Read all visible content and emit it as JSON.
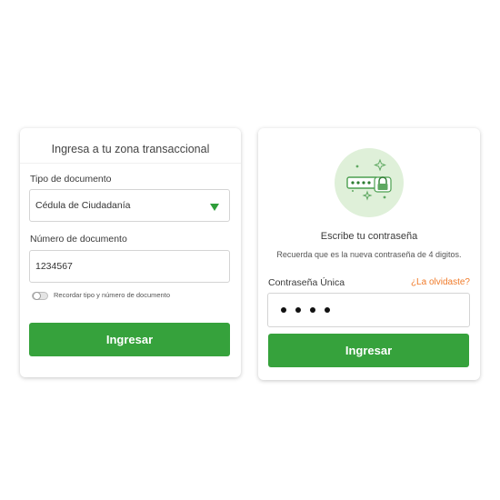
{
  "login": {
    "title": "Ingresa a tu zona transaccional",
    "doc_type_label": "Tipo de documento",
    "doc_type_value": "Cédula de Ciudadanía",
    "doc_number_label": "Número de documento",
    "doc_number_value": "1234567",
    "remember_label": "Recordar tipo y número de documento",
    "remember_on": false,
    "submit_label": "Ingresar"
  },
  "password": {
    "icon": "password-lock-icon",
    "title": "Escribe tu contraseña",
    "hint": "Recuerda que es la nueva contraseña de 4 digitos.",
    "field_label": "Contraseña Única",
    "forgot_label": "¿La olvidaste?",
    "masked_digits": 4,
    "submit_label": "Ingresar"
  },
  "colors": {
    "primary_green": "#36a23c",
    "arrow_green": "#2e9e3a",
    "icon_bg": "#dff0d9",
    "link_orange": "#f07b2a"
  }
}
